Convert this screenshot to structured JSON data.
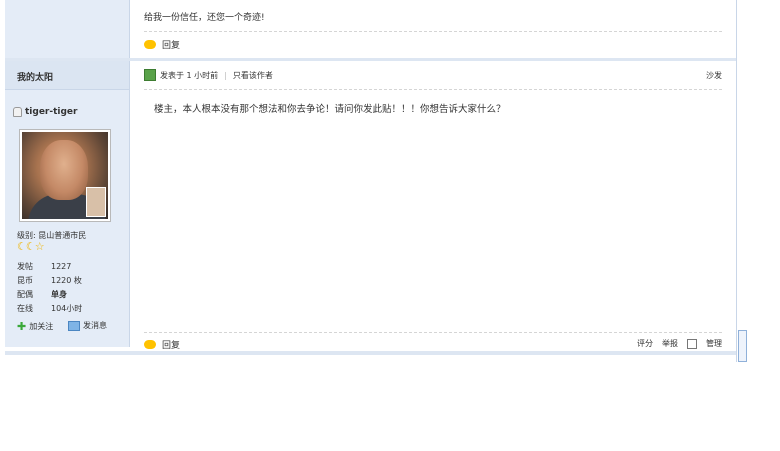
{
  "prev_post": {
    "signature": "给我一份信任，还您一个奇迹!",
    "reply_label": "回复"
  },
  "post": {
    "author_header": "我的太阳",
    "username": "tiger-tiger",
    "level_label": "级别: 昆山普通市民",
    "stats": [
      {
        "key": "发帖",
        "value": "1227"
      },
      {
        "key": "昆币",
        "value": "1220 枚"
      },
      {
        "key": "配偶",
        "value": "单身"
      },
      {
        "key": "在线",
        "value": "104小时"
      }
    ],
    "follow_label": "加关注",
    "message_label": "发消息",
    "posted_label": "发表于 1 小时前",
    "only_author_label": "只看该作者",
    "floor_label": "沙发",
    "content": "楼主，本人根本没有那个想法和你去争论！请问你发此贴！！！你想告诉大家什么？",
    "reply_label": "回复",
    "rate_label": "评分",
    "report_label": "举报",
    "manage_label": "管理"
  },
  "colors": {
    "sidebar_bg": "#e4ecf7",
    "border": "#c9d6e8",
    "reply_icon": "#ffc200",
    "moon": "#f0b400",
    "follow_icon": "#3aa83a"
  },
  "icons": [
    "reply-icon",
    "user-icon",
    "post-time-icon",
    "plus-icon",
    "message-icon",
    "moon-icon",
    "star-icon",
    "checkbox"
  ]
}
